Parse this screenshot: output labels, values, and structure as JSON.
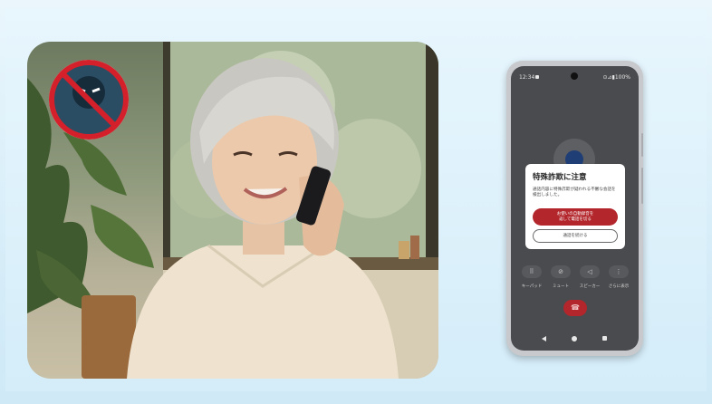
{
  "phone": {
    "status_time": "12:34",
    "status_right": "⊙⊿▮100%",
    "dialog": {
      "title": "特殊詐欺に注意",
      "body": "通話内容に特殊詐欺が疑われる不審な会話を検出しました。",
      "primary_line1": "お使いの自動録音を",
      "primary_line2": "返して電話を切る",
      "secondary": "通話を続ける"
    },
    "controls": [
      {
        "icon": "dialpad-icon",
        "label": "キーパッド"
      },
      {
        "icon": "mute-icon",
        "label": "ミュート"
      },
      {
        "icon": "speaker-icon",
        "label": "スピーカー"
      },
      {
        "icon": "more-icon",
        "label": "さらに表示"
      }
    ]
  },
  "colors": {
    "accent_red": "#b3262b",
    "background": "#d8eef9",
    "screen_bg": "#4a4b4e",
    "avatar": "#1f3e75"
  }
}
